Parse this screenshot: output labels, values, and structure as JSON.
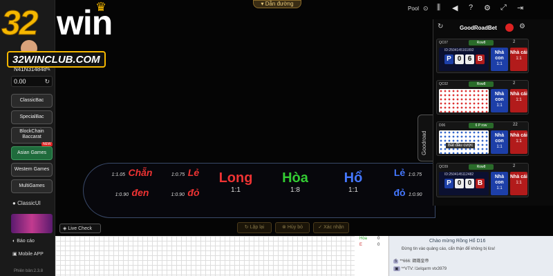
{
  "brand": {
    "logo_32": "32",
    "logo_win": "win",
    "club": "32WINCLUB.COM"
  },
  "user": {
    "name": "N41N314848",
    "balance": "0.00"
  },
  "sidebar": {
    "items": [
      {
        "label": "ClassicBac"
      },
      {
        "label": "SpecialBac"
      },
      {
        "label": "BlockChain Baccarat"
      },
      {
        "label": "Asian Games"
      },
      {
        "label": "Western Games"
      },
      {
        "label": "MultiGames"
      }
    ],
    "new_badge": "NEW",
    "classic_ui": "ClassicUI",
    "report": "Báo cáo",
    "mobile_app": "Mobile APP",
    "version": "Phiên bản:2.3.8"
  },
  "topbar": {
    "route_label": "Dẫn đường",
    "pool_label": "Pool"
  },
  "table": {
    "chan_ratio": "1:1.05",
    "chan_label": "Chẵn",
    "le_left_ratio": "1:0.75",
    "le_left_label": "Lẻ",
    "den_ratio": "1:0.90",
    "den_label": "đen",
    "do_left_ratio": "1:0.90",
    "do_left_label": "đỏ",
    "long_label": "Long",
    "long_ratio": "1:1",
    "hoa_label": "Hòa",
    "hoa_ratio": "1:8",
    "ho_label": "Hổ",
    "ho_ratio": "1:1",
    "le_right_label": "Lẻ",
    "le_right_ratio": "1:0.75",
    "do_right_label": "đỏ",
    "do_right_ratio": "1:0.90"
  },
  "goodroad": {
    "title": "GoodRoadBet",
    "tab_label": "Goodroad",
    "cards": [
      {
        "code": "QC07",
        "badge": "Row8",
        "count": "2",
        "id": "ID:2504145161892",
        "p": "P",
        "n1": "0",
        "n2": "6",
        "b": "B",
        "blue": "Nhà con",
        "blue_ratio": "1:1",
        "red": "Nhà cái",
        "red_ratio": "1:1"
      },
      {
        "code": "QC02",
        "badge": "Row8",
        "count": "2",
        "blue": "Nhà con",
        "blue_ratio": "1:1",
        "red": "Nhà cái",
        "red_ratio": "1:1"
      },
      {
        "code": "D06",
        "badge": "6 P row",
        "count": "22",
        "fade": "Bắt đầu cược",
        "blue": "Nhà con",
        "blue_ratio": "1:1",
        "red": "Nhà cái",
        "red_ratio": "1:1"
      },
      {
        "code": "QC09",
        "badge": "Row8",
        "count": "2",
        "id": "ID:2504145112482",
        "p": "P",
        "n1": "0",
        "n2": "0",
        "b": "B",
        "blue": "Nhà con",
        "blue_ratio": "1:1",
        "red": "Nhà cái",
        "red_ratio": "1:1"
      }
    ]
  },
  "actions": {
    "live_check": "Live Check",
    "replay": "Lặp lại",
    "cancel": "Hủy bỏ",
    "confirm": "Xác nhận"
  },
  "stats": {
    "hoa": "Hòa",
    "hoa_v": "0",
    "e": "E",
    "e_v": "0"
  },
  "chat": {
    "title": "Chào mừng Rồng Hổ D16",
    "notice": "Đừng tin vào quảng cáo, cẩn thận để không bị lừa!",
    "line1_tag": "5",
    "line1": "**666: 鋼鐵皇帝",
    "line2": "**VTV: l1eIqarm vtx3979"
  }
}
